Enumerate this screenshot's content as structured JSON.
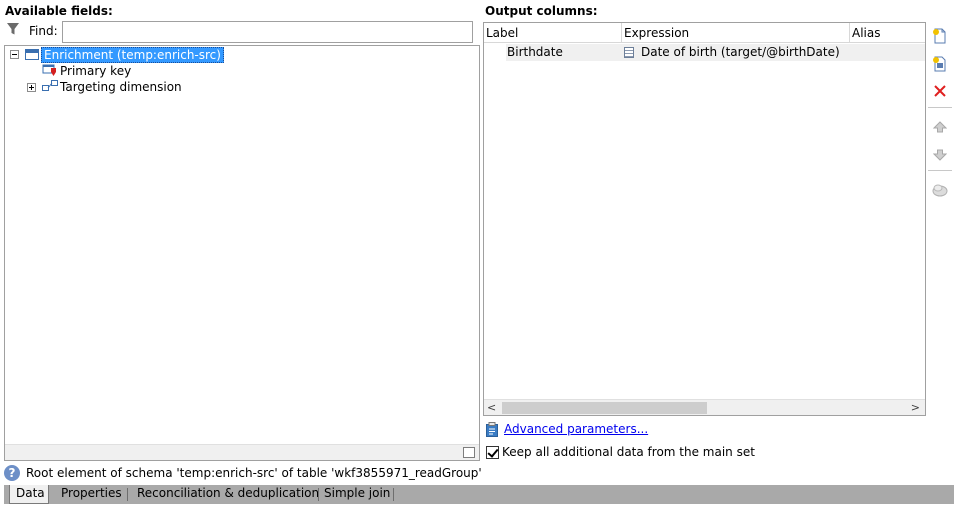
{
  "available_fields": {
    "title": "Available fields:",
    "find_label": "Find:",
    "find_value": "",
    "tree": [
      {
        "label": "Enrichment (temp:enrich-src)",
        "selected": true,
        "expanded": true
      },
      {
        "label": "Primary key"
      },
      {
        "label": "Targeting dimension",
        "expanded": false
      }
    ]
  },
  "output_columns": {
    "title": "Output columns:",
    "headers": [
      "Label",
      "Expression",
      "Alias"
    ],
    "rows": [
      {
        "label": "Birthdate",
        "expression": "Date of birth (target/@birthDate)",
        "alias": ""
      }
    ]
  },
  "toolbar": {
    "icons": [
      "add-icon",
      "edit-expression-icon",
      "delete-icon",
      "move-up-icon",
      "move-down-icon",
      "distribution-icon"
    ]
  },
  "advanced_link": "Advanced parameters...",
  "keep_data_label": "Keep all additional data from the main set",
  "keep_data_checked": true,
  "status_text": "Root element of schema 'temp:enrich-src' of table 'wkf3855971_readGroup'",
  "tabs": [
    "Data",
    "Properties",
    "Reconciliation & deduplication",
    "Simple join"
  ],
  "active_tab": "Data",
  "colors": {
    "selection": "#3399ff",
    "tab_bar": "#a9a9a9",
    "delete_icon": "#e02020",
    "link": "#0000ee"
  }
}
